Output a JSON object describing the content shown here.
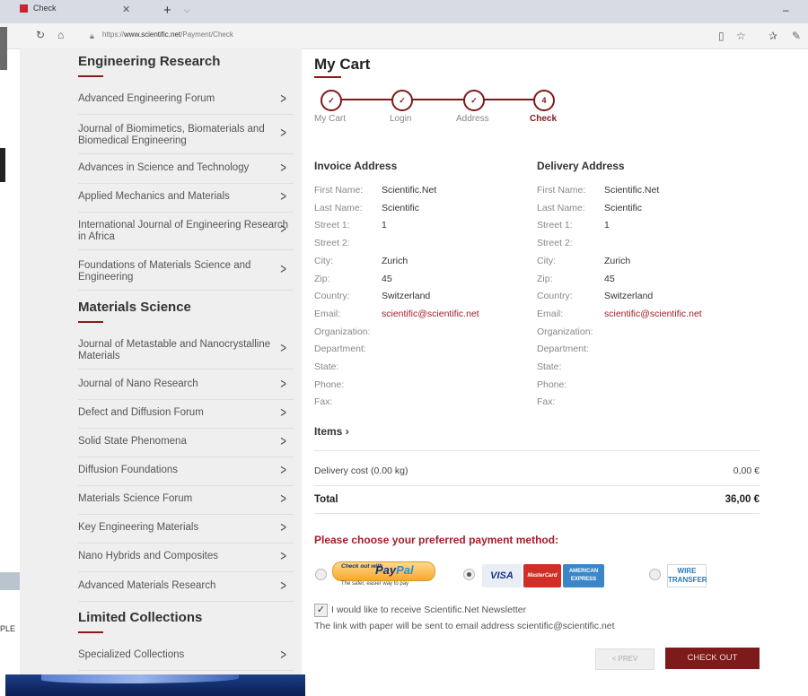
{
  "browser": {
    "tab_title": "Check",
    "url_prefix": "https://",
    "url_domain": "www.scientific.net",
    "url_path": "/Payment/Check"
  },
  "sidebar": {
    "sections": [
      {
        "heading": "Engineering Research",
        "items": [
          "Advanced Engineering Forum",
          "Journal of Biomimetics, Biomaterials and Biomedical Engineering",
          "Advances in Science and Technology",
          "Applied Mechanics and Materials",
          "International Journal of Engineering Research in Africa",
          "Foundations of Materials Science and Engineering"
        ]
      },
      {
        "heading": "Materials Science",
        "items": [
          "Journal of Metastable and Nanocrystalline Materials",
          "Journal of Nano Research",
          "Defect and Diffusion Forum",
          "Solid State Phenomena",
          "Diffusion Foundations",
          "Materials Science Forum",
          "Key Engineering Materials",
          "Nano Hybrids and Composites",
          "Advanced Materials Research"
        ]
      },
      {
        "heading": "Limited Collections",
        "items": [
          "Specialized Collections"
        ]
      }
    ]
  },
  "page_title": "My Cart",
  "steps": [
    {
      "label": "My Cart",
      "mark": "✓"
    },
    {
      "label": "Login",
      "mark": "✓"
    },
    {
      "label": "Address",
      "mark": "✓"
    },
    {
      "label": "Check",
      "mark": "4"
    }
  ],
  "invoice": {
    "heading": "Invoice Address",
    "fields": [
      {
        "label": "First Name:",
        "value": "Scientific.Net"
      },
      {
        "label": "Last Name:",
        "value": "Scientific"
      },
      {
        "label": "Street 1:",
        "value": "1"
      },
      {
        "label": "Street 2:",
        "value": ""
      },
      {
        "label": "City:",
        "value": "Zurich"
      },
      {
        "label": "Zip:",
        "value": "45"
      },
      {
        "label": "Country:",
        "value": "Switzerland"
      },
      {
        "label": "Email:",
        "value": "scientific@scientific.net"
      },
      {
        "label": "Organization:",
        "value": ""
      },
      {
        "label": "Department:",
        "value": ""
      },
      {
        "label": "State:",
        "value": ""
      },
      {
        "label": "Phone:",
        "value": ""
      },
      {
        "label": "Fax:",
        "value": ""
      }
    ]
  },
  "delivery": {
    "heading": "Delivery Address",
    "fields": [
      {
        "label": "First Name:",
        "value": "Scientific.Net"
      },
      {
        "label": "Last Name:",
        "value": "Scientific"
      },
      {
        "label": "Street 1:",
        "value": "1"
      },
      {
        "label": "Street 2:",
        "value": ""
      },
      {
        "label": "City:",
        "value": "Zurich"
      },
      {
        "label": "Zip:",
        "value": "45"
      },
      {
        "label": "Country:",
        "value": "Switzerland"
      },
      {
        "label": "Email:",
        "value": "scientific@scientific.net"
      },
      {
        "label": "Organization:",
        "value": ""
      },
      {
        "label": "Department:",
        "value": ""
      },
      {
        "label": "State:",
        "value": ""
      },
      {
        "label": "Phone:",
        "value": ""
      },
      {
        "label": "Fax:",
        "value": ""
      }
    ]
  },
  "items_label": "Items",
  "delivery_cost": {
    "label": "Delivery cost (0.00 kg)",
    "value": "0,00 €"
  },
  "total": {
    "label": "Total",
    "value": "36,00 €"
  },
  "payment": {
    "heading": "Please choose your preferred payment method:",
    "paypal_checkout": "Check out with",
    "paypal_logo_a": "Pay",
    "paypal_logo_b": "Pal",
    "paypal_tagline": "The safer, easier way to pay",
    "visa": "VISA",
    "mastercard": "MasterCard",
    "amex": "AMERICAN EXPRESS",
    "wire": "WIRE TRANSFER",
    "selected": "card"
  },
  "newsletter_label": "I would like to receive Scientific.Net Newsletter",
  "newsletter_checked": true,
  "link_info": "The link with paper will be sent to email address scientific@scientific.net",
  "buttons": {
    "prev": "< PREV",
    "checkout": "CHECK OUT"
  },
  "fragments": {
    "left_text": "PLE"
  },
  "colors": {
    "accent": "#7d1a1a",
    "link": "#a0202a",
    "sidebar_bg": "#efefef"
  }
}
